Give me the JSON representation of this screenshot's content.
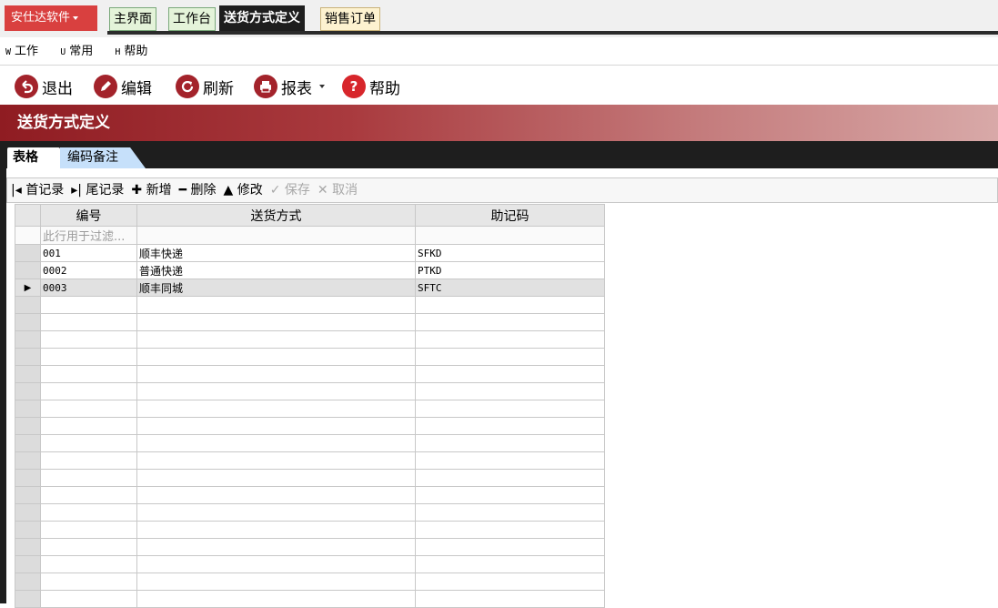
{
  "topbar": {
    "brand": "安仕达软件",
    "tabs": [
      {
        "label": "主界面"
      },
      {
        "label": "工作台"
      },
      {
        "label": "送货方式定义"
      },
      {
        "label": "销售订单"
      }
    ]
  },
  "menubar": {
    "items": [
      {
        "key": "W",
        "label": "工作"
      },
      {
        "key": "U",
        "label": "常用"
      },
      {
        "key": "H",
        "label": "帮助"
      }
    ]
  },
  "toolbar": {
    "exit": "退出",
    "edit": "编辑",
    "refresh": "刷新",
    "report": "报表",
    "help": "帮助",
    "colors": {
      "icon": "#a3232b"
    }
  },
  "section": {
    "title": "送货方式定义"
  },
  "innertabs": {
    "active": "表格",
    "other": "编码备注"
  },
  "navigator": {
    "first": "首记录",
    "last": "尾记录",
    "add": "新增",
    "delete": "删除",
    "modify": "修改",
    "save": "保存",
    "cancel": "取消"
  },
  "grid": {
    "headers": [
      "编号",
      "送货方式",
      "助记码"
    ],
    "filter_hint": "此行用于过滤...",
    "rows": [
      {
        "code": "001",
        "method": "顺丰快递",
        "mnemonic": "SFKD"
      },
      {
        "code": "0002",
        "method": "普通快递",
        "mnemonic": "PTKD"
      },
      {
        "code": "0003",
        "method": "顺丰同城",
        "mnemonic": "SFTC"
      }
    ]
  }
}
